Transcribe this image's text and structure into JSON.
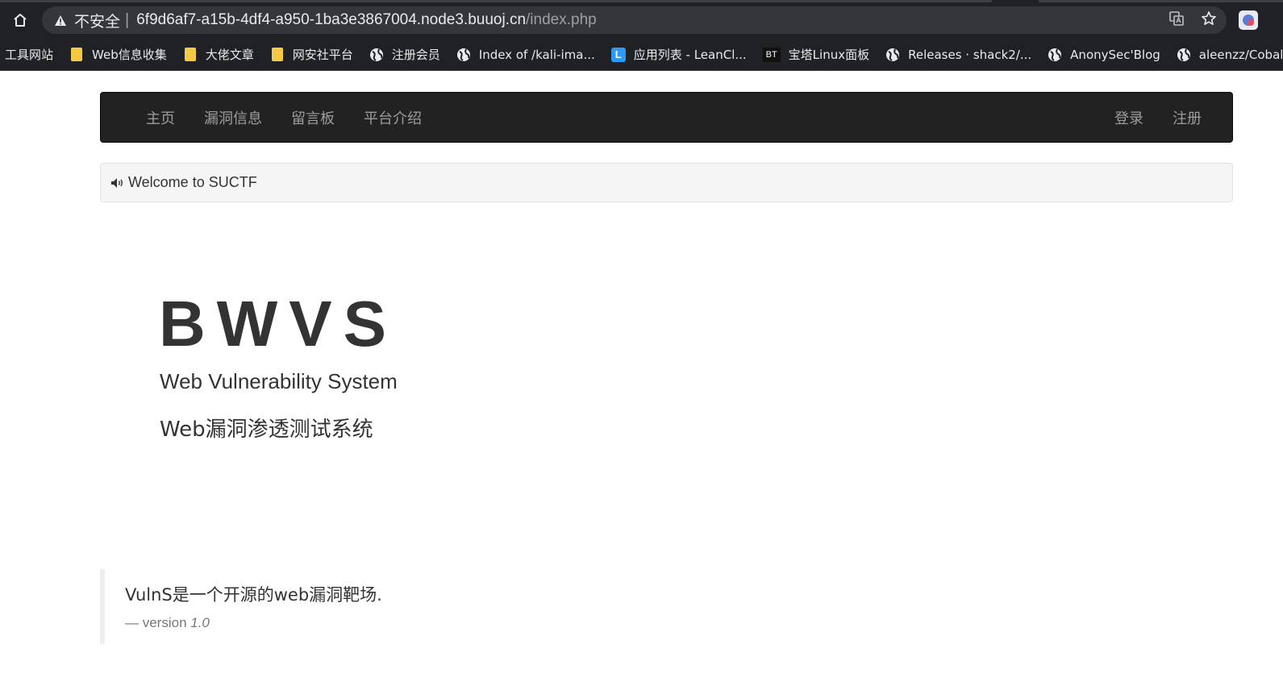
{
  "browser": {
    "security_label": "不安全",
    "separator": "|",
    "url_host": "6f9d6af7-a15b-4df4-a950-1ba3e3867004.node3.buuoj.cn",
    "url_path": "/index.php",
    "icons": [
      "home-icon",
      "warning-icon",
      "translate-icon",
      "star-icon",
      "extension-icon"
    ]
  },
  "bookmarks": [
    {
      "label": "工具网站",
      "icon": "none"
    },
    {
      "label": "Web信息收集",
      "icon": "folder-icon"
    },
    {
      "label": "大佬文章",
      "icon": "folder-icon"
    },
    {
      "label": "网安社平台",
      "icon": "folder-icon"
    },
    {
      "label": "注册会员",
      "icon": "globe-icon"
    },
    {
      "label": "Index of /kali-ima...",
      "icon": "globe-icon"
    },
    {
      "label": "应用列表 - LeanCl...",
      "icon": "leancloud-icon",
      "badge": "L"
    },
    {
      "label": "宝塔Linux面板",
      "icon": "bt-icon",
      "badge": "BT"
    },
    {
      "label": "Releases · shack2/...",
      "icon": "globe-icon"
    },
    {
      "label": "AnonySec'Blog",
      "icon": "globe-icon"
    },
    {
      "label": "aleenzz/Cobal",
      "icon": "globe-icon"
    }
  ],
  "navbar": {
    "left": [
      "主页",
      "漏洞信息",
      "留言板",
      "平台介绍"
    ],
    "right": [
      "登录",
      "注册"
    ]
  },
  "welcome": {
    "text": "Welcome to SUCTF"
  },
  "hero": {
    "title": "BWVS",
    "subtitle_en": "Web Vulnerability System",
    "subtitle_cn": "Web漏洞渗透测试系统"
  },
  "quote": {
    "text": "VulnS是一个开源的web漏洞靶场.",
    "footer_prefix": "— version ",
    "version": "1.0"
  },
  "colors": {
    "navbar_bg": "#222222",
    "nav_text": "#9d9d9d",
    "chrome_bg": "#202124",
    "omnibox_bg": "#35363a",
    "folder": "#f6c945"
  }
}
